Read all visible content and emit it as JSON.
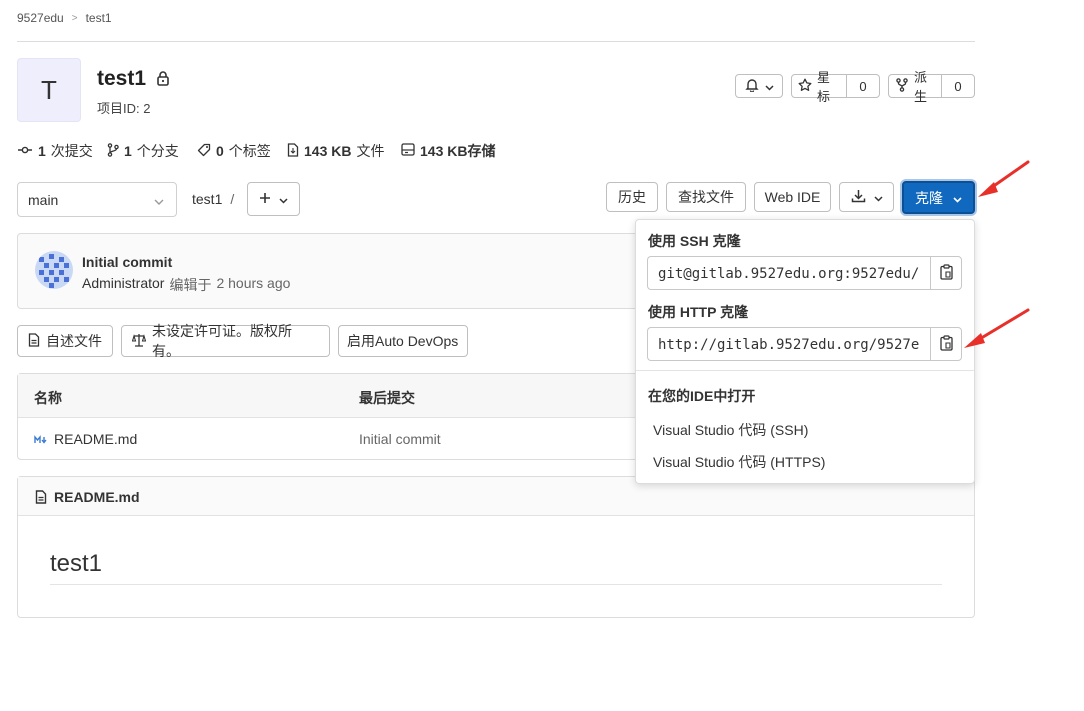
{
  "breadcrumb": {
    "group": "9527edu",
    "separator": ">",
    "project": "test1"
  },
  "project": {
    "avatar_letter": "T",
    "name": "test1",
    "id_label": "项目ID: 2"
  },
  "actions": {
    "star_label": "星标",
    "star_count": "0",
    "fork_label": "派生",
    "fork_count": "0"
  },
  "stats": {
    "commits_count": "1",
    "commits_label": "次提交",
    "branches_count": "1",
    "branches_label": "个分支",
    "tags_count": "0",
    "tags_label": "个标签",
    "files_size": "143 KB",
    "files_label": "文件",
    "storage_size": "143 KB",
    "storage_label": "存储"
  },
  "toolbar": {
    "branch": "main",
    "path": "test1",
    "path_sep": "/",
    "history": "历史",
    "find_file": "查找文件",
    "web_ide": "Web IDE",
    "clone": "克隆"
  },
  "commit": {
    "title": "Initial commit",
    "author": "Administrator",
    "verb": "编辑于",
    "time": "2 hours ago"
  },
  "chips": {
    "readme": "自述文件",
    "license": "未设定许可证。版权所有。",
    "devops": "启用Auto DevOps"
  },
  "table": {
    "col_name": "名称",
    "col_last_commit": "最后提交",
    "rows": [
      {
        "name": "README.md",
        "commit": "Initial commit"
      }
    ]
  },
  "readme": {
    "filename": "README.md",
    "heading": "test1"
  },
  "clone_dropdown": {
    "ssh_label": "使用 SSH 克隆",
    "ssh_url": "git@gitlab.9527edu.org:9527edu/",
    "http_label": "使用 HTTP 克隆",
    "http_url": "http://gitlab.9527edu.org/9527e",
    "ide_title": "在您的IDE中打开",
    "ide_ssh": "Visual Studio 代码 (SSH)",
    "ide_https": "Visual Studio 代码 (HTTPS)"
  },
  "colors": {
    "primary": "#1068bf",
    "annotation_arrow": "#e8302a",
    "avatar_bg": "#eeeefc"
  }
}
